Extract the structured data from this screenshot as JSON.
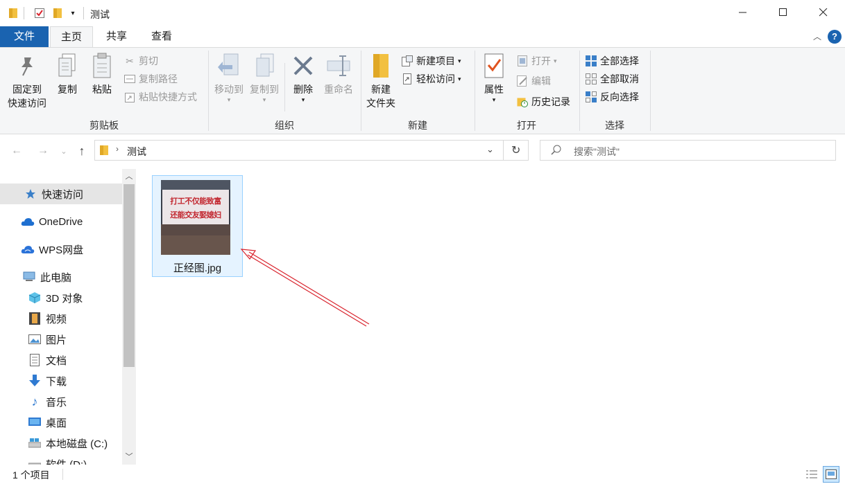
{
  "window": {
    "title": "测试",
    "controls": {
      "minimize": "minimize-icon",
      "maximize": "maximize-icon",
      "close": "close-icon"
    }
  },
  "ribbon_tabs": [
    {
      "label": "文件"
    },
    {
      "label": "主页"
    },
    {
      "label": "共享"
    },
    {
      "label": "查看"
    }
  ],
  "ribbon": {
    "clipboard": {
      "label": "剪贴板",
      "pin": "固定到",
      "pin2": "快速访问",
      "copy": "复制",
      "paste": "粘贴",
      "cut": "剪切",
      "copy_path": "复制路径",
      "paste_shortcut": "粘贴快捷方式"
    },
    "organize": {
      "label": "组织",
      "move_to": "移动到",
      "copy_to": "复制到",
      "delete": "删除",
      "rename": "重命名"
    },
    "new": {
      "label": "新建",
      "new_folder": "新建",
      "new_folder2": "文件夹",
      "new_item": "新建项目",
      "easy_access": "轻松访问"
    },
    "open": {
      "label": "打开",
      "properties": "属性",
      "open": "打开",
      "edit": "编辑",
      "history": "历史记录"
    },
    "select": {
      "label": "选择",
      "select_all": "全部选择",
      "select_none": "全部取消",
      "invert": "反向选择"
    }
  },
  "address": {
    "path": "测试",
    "search_placeholder": "搜索\"测试\""
  },
  "nav_pane": [
    {
      "label": "快速访问",
      "icon": "star-icon"
    },
    {
      "label": "OneDrive",
      "icon": "cloud-icon"
    },
    {
      "label": "WPS网盘",
      "icon": "cloud-icon"
    },
    {
      "label": "此电脑",
      "icon": "computer-icon"
    },
    {
      "label": "3D 对象",
      "icon": "cube-icon"
    },
    {
      "label": "视频",
      "icon": "film-icon"
    },
    {
      "label": "图片",
      "icon": "picture-icon"
    },
    {
      "label": "文档",
      "icon": "document-icon"
    },
    {
      "label": "下载",
      "icon": "download-icon"
    },
    {
      "label": "音乐",
      "icon": "music-icon"
    },
    {
      "label": "桌面",
      "icon": "desktop-icon"
    },
    {
      "label": "本地磁盘 (C:)",
      "icon": "drive-icon"
    },
    {
      "label": "软件 (D:)",
      "icon": "drive-icon"
    }
  ],
  "files": [
    {
      "name": "正经图.jpg",
      "thumb_line1": "打工不仅能致富",
      "thumb_line2": "还能交友娶媳妇"
    }
  ],
  "status": {
    "count": "1 个项目"
  },
  "colors": {
    "accent": "#1a63b0",
    "selection": "#cce8ff",
    "arrow": "#d9232d"
  }
}
